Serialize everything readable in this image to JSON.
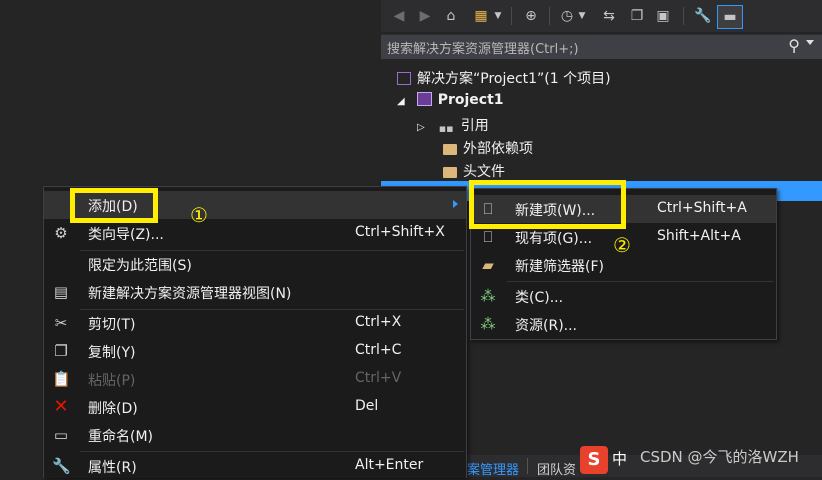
{
  "solution_explorer": {
    "toolbar_icons": [
      "back-icon",
      "forward-icon",
      "home-icon",
      "switch-views-icon",
      "chevron-down-icon",
      "globe-icon",
      "pending-changes-icon",
      "chevron-down-icon",
      "sync-icon",
      "copy-icon",
      "properties-icon",
      "auto-hide-icon"
    ],
    "search_placeholder": "搜索解决方案资源管理器(Ctrl+;)",
    "tree": [
      {
        "label": "解决方案“Project1”(1 个项目)",
        "icon": "solution-icon"
      },
      {
        "label": "Project1",
        "icon": "project-icon"
      },
      {
        "label": "引用",
        "icon": "references-icon"
      },
      {
        "label": "外部依赖项",
        "icon": "folder-icon"
      },
      {
        "label": "头文件",
        "icon": "folder-icon"
      }
    ],
    "tabs": [
      "案管理器",
      "团队资"
    ]
  },
  "context_menu": {
    "items": [
      {
        "label": "添加(D)",
        "shortcut": "",
        "icon": "",
        "submenu": true
      },
      {
        "label": "类向导(Z)...",
        "shortcut": "Ctrl+Shift+X",
        "icon": "class-wizard-icon"
      },
      {
        "label": "限定为此范围(S)",
        "shortcut": "",
        "icon": ""
      },
      {
        "label": "新建解决方案资源管理器视图(N)",
        "shortcut": "",
        "icon": "new-view-icon"
      },
      {
        "label": "剪切(T)",
        "shortcut": "Ctrl+X",
        "icon": "cut-icon"
      },
      {
        "label": "复制(Y)",
        "shortcut": "Ctrl+C",
        "icon": "copy-icon"
      },
      {
        "label": "粘贴(P)",
        "shortcut": "Ctrl+V",
        "icon": "paste-icon",
        "disabled": true
      },
      {
        "label": "删除(D)",
        "shortcut": "Del",
        "icon": "delete-icon"
      },
      {
        "label": "重命名(M)",
        "shortcut": "",
        "icon": "rename-icon"
      },
      {
        "label": "属性(R)",
        "shortcut": "Alt+Enter",
        "icon": "wrench-icon"
      }
    ]
  },
  "submenu": {
    "items": [
      {
        "label": "新建项(W)...",
        "shortcut": "Ctrl+Shift+A",
        "icon": "new-item-icon"
      },
      {
        "label": "现有项(G)...",
        "shortcut": "Shift+Alt+A",
        "icon": "existing-item-icon"
      },
      {
        "label": "新建筛选器(F)",
        "shortcut": "",
        "icon": "new-filter-icon"
      },
      {
        "label": "类(C)...",
        "shortcut": "",
        "icon": "class-icon"
      },
      {
        "label": "资源(R)...",
        "shortcut": "",
        "icon": "resource-icon"
      }
    ]
  },
  "annotations": {
    "step1": "①",
    "step2": "②",
    "highlight_color": "#ffee00"
  },
  "watermark": "CSDN @今飞的洛WZH",
  "ime": {
    "label": "中"
  }
}
